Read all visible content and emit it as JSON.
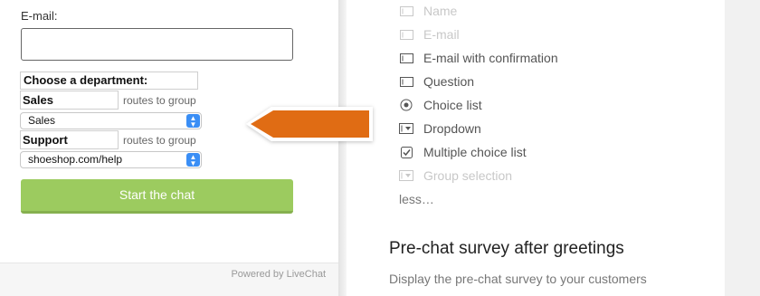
{
  "chat_form": {
    "email_label": "E-mail:",
    "email_value": "",
    "department_heading": "Choose a department:",
    "departments": [
      {
        "name": "Sales",
        "routes_label": "routes to group",
        "selected_group": "Sales"
      },
      {
        "name": "Support",
        "routes_label": "routes to group",
        "selected_group": "shoeshop.com/help"
      }
    ],
    "start_button": "Start the chat",
    "powered_by": "Powered by LiveChat"
  },
  "field_types": {
    "items": [
      {
        "label": "Name",
        "icon": "text-field-icon",
        "enabled": false
      },
      {
        "label": "E-mail",
        "icon": "text-field-icon",
        "enabled": false
      },
      {
        "label": "E-mail with confirmation",
        "icon": "text-field-icon",
        "enabled": true
      },
      {
        "label": "Question",
        "icon": "text-field-icon",
        "enabled": true
      },
      {
        "label": "Choice list",
        "icon": "radio-icon",
        "enabled": true
      },
      {
        "label": "Dropdown",
        "icon": "dropdown-icon",
        "enabled": true
      },
      {
        "label": "Multiple choice list",
        "icon": "checkbox-icon",
        "enabled": true
      },
      {
        "label": "Group selection",
        "icon": "dropdown-icon",
        "enabled": false
      }
    ],
    "less_link": "less…"
  },
  "section": {
    "title": "Pre-chat survey after greetings",
    "description": "Display the pre-chat survey to your customers"
  },
  "colors": {
    "button": "#9ccb5f",
    "arrow": "#e06c14",
    "select_stepper": "#3a8ef5"
  }
}
